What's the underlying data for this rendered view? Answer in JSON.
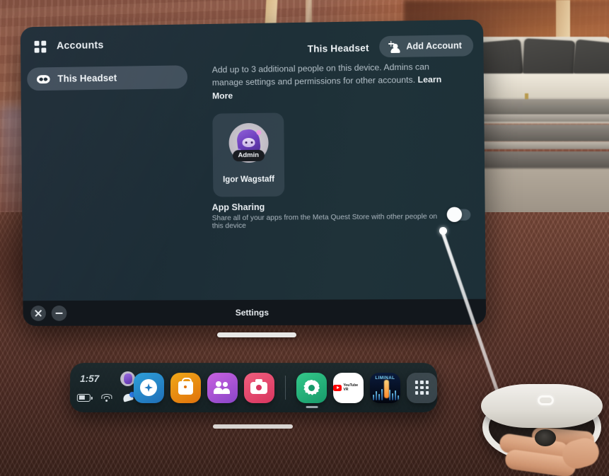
{
  "window": {
    "sidebar": {
      "grid_icon": "grid-icon",
      "title": "Accounts",
      "items": [
        {
          "label": "This Headset",
          "icon": "headset-icon",
          "selected": true
        }
      ]
    },
    "content": {
      "title": "This Headset",
      "add_account": {
        "label": "Add Account",
        "icon": "person-add-icon"
      },
      "description_part1": "Add up to 3 additional people on this device. Admins can manage settings and permissions for other accounts. ",
      "learn_more": "Learn More",
      "accounts": [
        {
          "name": "Igor Wagstaff",
          "badge": "Admin"
        }
      ],
      "app_sharing": {
        "title": "App Sharing",
        "subtitle": "Share all of your apps from the Meta Quest Store with other people on this device",
        "toggle_state": "off"
      }
    },
    "bottom_bar": {
      "title": "Settings",
      "close_label": "close-icon",
      "minimize_label": "minimize-icon"
    }
  },
  "dock": {
    "clock": "1:57",
    "status_icons": [
      "battery-icon",
      "wifi-icon",
      "notification-bell-icon"
    ],
    "avatar": "user-avatar",
    "apps": [
      {
        "name": "Explore",
        "icon": "explore-icon",
        "color": "#2079bf"
      },
      {
        "name": "Store",
        "icon": "store-bag-icon",
        "color": "#e0720c"
      },
      {
        "name": "People",
        "icon": "people-icon",
        "color": "#8a45c8"
      },
      {
        "name": "Camera",
        "icon": "camera-icon",
        "color": "#d8355f"
      },
      {
        "name": "Settings",
        "icon": "gear-icon",
        "color": "#179a6a",
        "active": true
      },
      {
        "name": "YouTube VR",
        "icon": "youtube-icon",
        "color": "#ffffff",
        "label": "YouTube VR"
      },
      {
        "name": "LIMINAL",
        "icon": "liminal-icon",
        "color": "#03060f",
        "label": "LIMINAL"
      },
      {
        "name": "All Apps",
        "icon": "app-grid-icon",
        "color": "#7e8c98"
      }
    ]
  },
  "colors": {
    "panel_bg": "#1d2e37",
    "accent_blue": "#2f7ff0",
    "text_primary": "#eef3f6",
    "text_secondary": "#b5c1c9"
  }
}
